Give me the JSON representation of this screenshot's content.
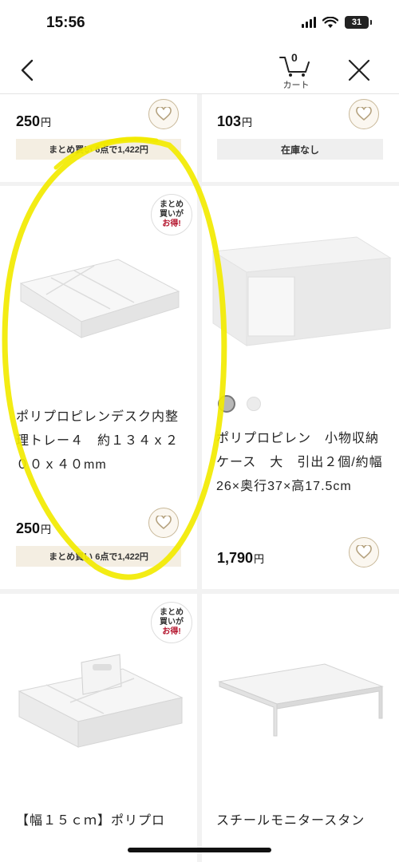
{
  "status_bar": {
    "time": "15:56",
    "battery": "31"
  },
  "nav": {
    "cart_count": "0",
    "cart_label": "カート"
  },
  "products": [
    {
      "price": "250",
      "currency": "円",
      "promo": "まとめ買い 6点で1,422円"
    },
    {
      "price": "103",
      "currency": "円",
      "stock": "在庫なし"
    },
    {
      "badge": [
        "まとめ",
        "買いが",
        "お得!"
      ],
      "name": "ポリプロピレンデスク内整理トレー４　約１３４ｘ２００ｘ４０mm",
      "price": "250",
      "currency": "円",
      "promo": "まとめ買い 6点で1,422円"
    },
    {
      "name": "ポリプロピレン　小物収納ケース　大　引出２個/約幅26×奥行37×高17.5cm",
      "price": "1,790",
      "currency": "円",
      "swatches": [
        "#b8b8b8",
        "#ececec"
      ]
    },
    {
      "badge": [
        "まとめ",
        "買いが",
        "お得!"
      ],
      "name": "【幅１５ｃｍ】ポリプロ"
    },
    {
      "name": "スチールモニタースタン"
    }
  ],
  "colors": {
    "favorite_border": "#c9b99a",
    "promo_bg": "#f4eee2",
    "badge_accent": "#b3112a",
    "highlight": "#f2ea00"
  }
}
